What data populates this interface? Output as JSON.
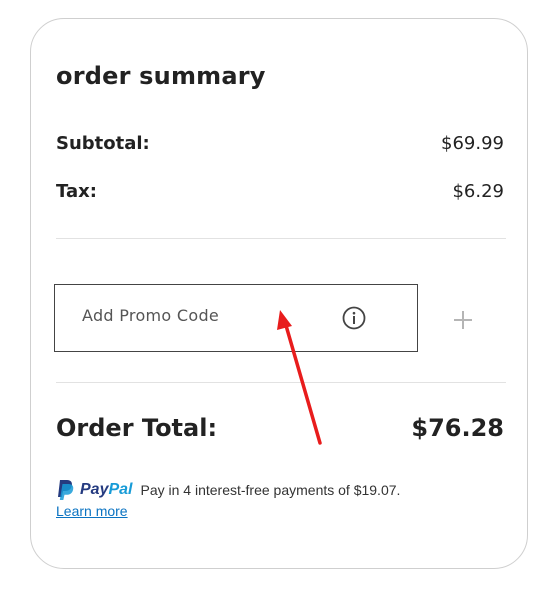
{
  "summary": {
    "title": "order summary",
    "subtotal_label": "Subtotal:",
    "subtotal_value": "$69.99",
    "tax_label": "Tax:",
    "tax_value": "$6.29",
    "total_label": "Order Total:",
    "total_value": "$76.28"
  },
  "promo": {
    "placeholder": "Add Promo Code",
    "info_icon": "info-circle-icon",
    "add_icon": "plus-icon"
  },
  "paypal": {
    "brand_pay": "Pay",
    "brand_pal": "Pal",
    "message": "Pay in 4 interest-free payments of $19.07.",
    "learn_more": "Learn more"
  },
  "colors": {
    "paypal_dark": "#253b80",
    "paypal_light": "#179bd7",
    "link": "#0a73c2",
    "annotation_arrow": "#e81c1c"
  }
}
